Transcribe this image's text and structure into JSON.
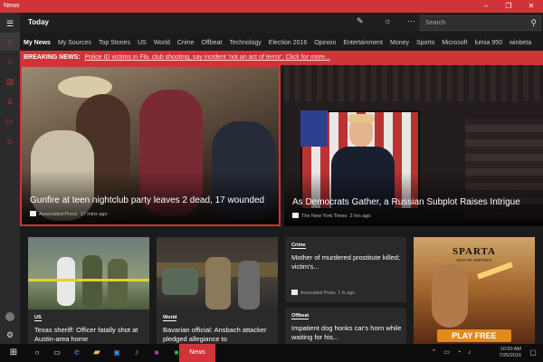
{
  "window": {
    "title": "News",
    "minimize": "–",
    "maximize": "❐",
    "close": "✕"
  },
  "rail": {
    "items": [
      "menu-icon",
      "home-icon",
      "star-icon",
      "document-icon",
      "account-icon",
      "video-icon",
      "emoji-icon",
      "avatar",
      "settings-icon"
    ]
  },
  "appbar": {
    "title": "Today",
    "search_placeholder": "Search"
  },
  "nav": {
    "tabs": [
      "My News",
      "My Sources",
      "Top Stories",
      "US",
      "World",
      "Crime",
      "Offbeat",
      "Technology",
      "Election 2016",
      "Opinion",
      "Entertainment",
      "Money",
      "Sports",
      "Microsoft",
      "lumia 950",
      "winbeta"
    ],
    "active": "My News"
  },
  "breaking": {
    "label": "BREAKING NEWS:",
    "text": "Police ID victims in Fla. club shooting, say incident 'not an act of terror'. Click for more..."
  },
  "heroes": [
    {
      "headline": "Gunfire at teen nightclub party leaves 2 dead, 17 wounded",
      "source": "Associated Press",
      "time": "17 mins ago"
    },
    {
      "headline": "As Democrats Gather, a Russian Subplot Raises Intrigue",
      "source": "The New York Times",
      "time": "2 hrs ago"
    }
  ],
  "cards": [
    {
      "category": "US",
      "headline": "Texas sheriff: Officer fatally shot at Austin-area home"
    },
    {
      "category": "World",
      "headline": "Bavarian official: Ansbach attacker pledged allegiance to"
    },
    {
      "category": "Crime",
      "headline": "Mother of murdered prostitute killed; victim's...",
      "source": "Associated Press",
      "time": "1 hr ago"
    },
    {
      "category": "Offbeat",
      "headline": "Impatient dog honks car's horn while waiting for his..."
    }
  ],
  "ad": {
    "title": "SPARTA",
    "subtitle": "WAR OF EMPIRES",
    "cta": "PLAY FREE"
  },
  "taskbar": {
    "app_label": "News",
    "time": "10:50 AM",
    "date": "7/25/2016"
  }
}
